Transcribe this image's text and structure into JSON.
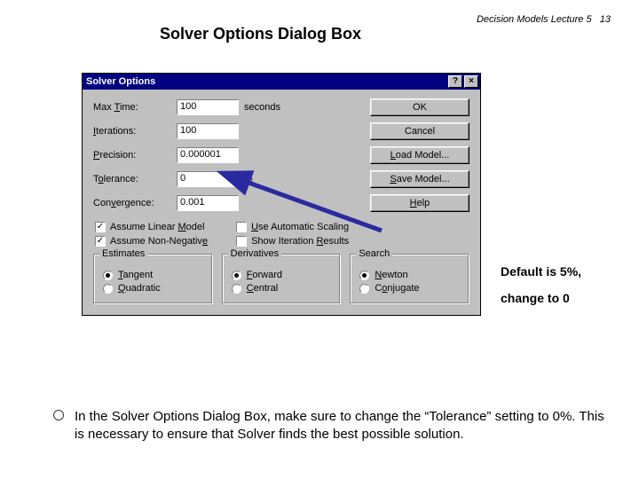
{
  "header": {
    "text": "Decision Models  Lecture 5",
    "page_no": "13"
  },
  "title": "Solver Options Dialog Box",
  "dialog": {
    "title": "Solver Options",
    "titlebar_buttons": {
      "help": "?",
      "close": "×"
    },
    "rows": {
      "maxtime": {
        "label_pre": "Max ",
        "label_u": "T",
        "label_post": "ime:",
        "value": "100",
        "unit": "seconds"
      },
      "iterations": {
        "label_u": "I",
        "label_post": "terations:",
        "value": "100",
        "unit": ""
      },
      "precision": {
        "label_u": "P",
        "label_post": "recision:",
        "value": "0.000001",
        "unit": ""
      },
      "tolerance": {
        "label_pre": "T",
        "label_u": "o",
        "label_post": "lerance:",
        "value": "0",
        "unit": "%"
      },
      "convergence": {
        "label_pre": "Con",
        "label_u": "v",
        "label_post": "ergence:",
        "value": "0.001",
        "unit": ""
      }
    },
    "buttons": {
      "ok": "OK",
      "cancel": "Cancel",
      "load_pre": "",
      "load_u": "L",
      "load_post": "oad Model...",
      "save_pre": "",
      "save_u": "S",
      "save_post": "ave Model...",
      "help_pre": "",
      "help_u": "H",
      "help_post": "elp"
    },
    "checks": {
      "linear": {
        "pre": "Assume Linear ",
        "u": "M",
        "post": "odel",
        "checked": "✓"
      },
      "nonneg": {
        "pre": "Assume Non-Negativ",
        "u": "e",
        "post": "",
        "checked": "✓"
      },
      "scaling": {
        "pre": "",
        "u": "U",
        "post": "se Automatic Scaling",
        "checked": ""
      },
      "show": {
        "pre": "Show Iteration ",
        "u": "R",
        "post": "esults",
        "checked": ""
      }
    },
    "groups": {
      "estimates": {
        "legend": "Estimates",
        "opt1": {
          "u": "T",
          "post": "angent",
          "selected": true
        },
        "opt2": {
          "u": "Q",
          "post": "uadratic",
          "selected": false
        }
      },
      "derivatives": {
        "legend": "Derivatives",
        "opt1": {
          "u": "F",
          "post": "orward",
          "selected": true
        },
        "opt2": {
          "u": "C",
          "post": "entral",
          "selected": false
        }
      },
      "search": {
        "legend": "Search",
        "opt1": {
          "u": "N",
          "post": "ewton",
          "selected": true
        },
        "opt2": {
          "pre": "C",
          "u": "o",
          "post": "njugate",
          "selected": false
        }
      }
    }
  },
  "annotation": {
    "line1": "Default is 5%,",
    "line2": "change to 0"
  },
  "note": "In the Solver Options Dialog Box, make sure to change the “Tolerance” setting to 0%.  This is necessary to ensure that Solver finds the best possible solution."
}
